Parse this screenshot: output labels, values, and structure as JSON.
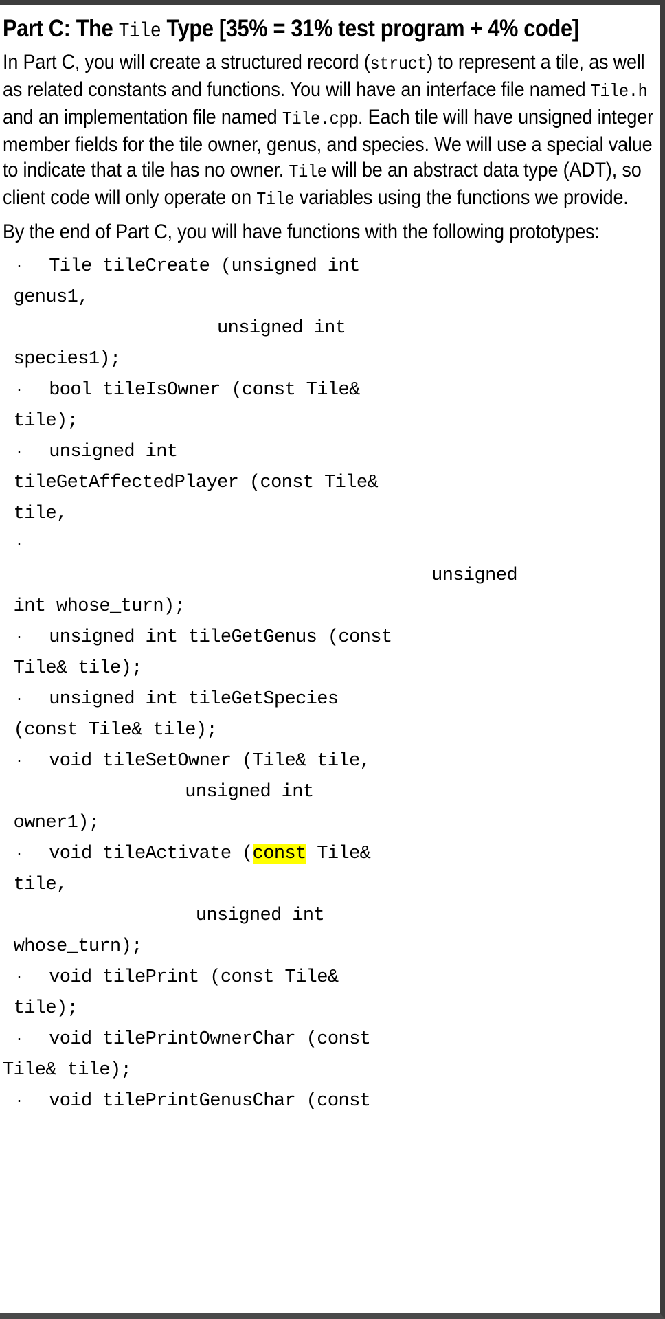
{
  "document": {
    "heading": {
      "prefix": "Part C: The ",
      "code": "Tile",
      "suffix": " Type [35% = 31% test program + 4% code]"
    },
    "paragraphs": [
      {
        "id": "intro",
        "segments": [
          {
            "type": "text",
            "value": "In Part C, you will create a structured record ("
          },
          {
            "type": "code",
            "value": "struct"
          },
          {
            "type": "text",
            "value": ") to represent a tile, as well as related constants and functions.  You will have an interface file named "
          },
          {
            "type": "code",
            "value": "Tile.h"
          },
          {
            "type": "text",
            "value": " and an implementation file named "
          },
          {
            "type": "code",
            "value": "Tile.cpp"
          },
          {
            "type": "text",
            "value": ".  Each tile will have unsigned integer member fields for the tile owner, genus, and species.  We will use a special value to indicate that a tile has no owner.  "
          },
          {
            "type": "code",
            "value": "Tile"
          },
          {
            "type": "text",
            "value": " will be an abstract data type (ADT), so client code will only operate on "
          },
          {
            "type": "code",
            "value": "Tile"
          },
          {
            "type": "text",
            "value": " variables using the functions we provide."
          }
        ]
      },
      {
        "id": "prototypes-lead",
        "segments": [
          {
            "type": "text",
            "value": "By the end of Part C, you will have functions with the following prototypes:"
          }
        ]
      }
    ],
    "prototypes": [
      {
        "bullet": "·",
        "lines": [
          {
            "indent": "first",
            "text": "  Tile tileCreate (unsigned int"
          },
          {
            "indent": "cont",
            "text": " genus1,"
          },
          {
            "indent": "cont",
            "text": "                    unsigned int"
          },
          {
            "indent": "cont",
            "text": " species1);"
          }
        ]
      },
      {
        "bullet": "·",
        "lines": [
          {
            "indent": "first",
            "text": "  bool tileIsOwner (const Tile&"
          },
          {
            "indent": "cont",
            "text": " tile);"
          }
        ]
      },
      {
        "bullet": "·",
        "lines": [
          {
            "indent": "first",
            "text": "  unsigned int"
          },
          {
            "indent": "cont",
            "text": " tileGetAffectedPlayer (const Tile&"
          },
          {
            "indent": "cont",
            "text": " tile,"
          }
        ]
      },
      {
        "bullet": "·",
        "lines": [
          {
            "indent": "blank",
            "text": ""
          },
          {
            "indent": "overflow",
            "text": "                                        unsigned"
          },
          {
            "indent": "cont",
            "text": " int whose_turn);"
          }
        ]
      },
      {
        "bullet": "·",
        "lines": [
          {
            "indent": "first",
            "text": "  unsigned int tileGetGenus (const"
          },
          {
            "indent": "cont",
            "text": " Tile& tile);"
          }
        ]
      },
      {
        "bullet": "·",
        "lines": [
          {
            "indent": "first",
            "text": "  unsigned int tileGetSpecies"
          },
          {
            "indent": "cont",
            "text": " (const Tile& tile);"
          }
        ]
      },
      {
        "bullet": "·",
        "lines": [
          {
            "indent": "first",
            "text": "  void tileSetOwner (Tile& tile,"
          },
          {
            "indent": "cont",
            "text": "                 unsigned int"
          },
          {
            "indent": "cont",
            "text": " owner1);"
          }
        ]
      },
      {
        "bullet": "·",
        "highlight": {
          "line": 0,
          "word": "const"
        },
        "lines": [
          {
            "indent": "first",
            "text": "  void tileActivate (const Tile&"
          },
          {
            "indent": "cont",
            "text": " tile,"
          },
          {
            "indent": "cont",
            "text": "                  unsigned int"
          },
          {
            "indent": "cont",
            "text": " whose_turn);"
          }
        ]
      },
      {
        "bullet": "·",
        "lines": [
          {
            "indent": "first",
            "text": "  void tilePrint (const Tile&"
          },
          {
            "indent": "cont",
            "text": " tile);"
          }
        ]
      },
      {
        "bullet": "·",
        "lines": [
          {
            "indent": "first",
            "text": "  void tilePrintOwnerChar (const"
          },
          {
            "indent": "cont",
            "text": "Tile& tile);"
          }
        ]
      },
      {
        "bullet": "·",
        "lines": [
          {
            "indent": "first",
            "text": "  void tilePrintGenusChar (const"
          }
        ]
      }
    ],
    "colors": {
      "highlight": "#ffff00",
      "text": "#000000",
      "page_background": "#ffffff",
      "chrome": "#3d3d3d"
    }
  }
}
